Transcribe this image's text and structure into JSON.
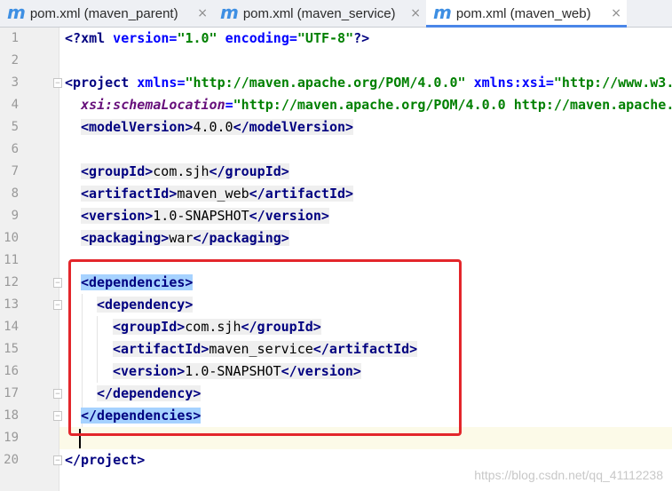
{
  "tabs": [
    {
      "icon": "m",
      "label": "pom.xml (maven_parent)",
      "close": "×",
      "active": false
    },
    {
      "icon": "m",
      "label": "pom.xml (maven_service)",
      "close": "×",
      "active": false
    },
    {
      "icon": "m",
      "label": "pom.xml (maven_web)",
      "close": "×",
      "active": true
    }
  ],
  "line_numbers": [
    "1",
    "2",
    "3",
    "4",
    "5",
    "6",
    "7",
    "8",
    "9",
    "10",
    "11",
    "12",
    "13",
    "14",
    "15",
    "16",
    "17",
    "18",
    "19",
    "20"
  ],
  "code": {
    "l1": {
      "a": "<?",
      "b": "xml",
      "c": " version",
      "d": "=",
      "e": "\"1.0\"",
      "f": " encoding",
      "g": "=",
      "h": "\"UTF-8\"",
      "i": "?>"
    },
    "l3": {
      "a": "<project",
      "b": " xmlns",
      "c": "=",
      "d": "\"http://maven.apache.org/POM/4.0.0\"",
      "e": " xmlns:xsi",
      "f": "=",
      "g": "\"http://www.w3."
    },
    "l4": {
      "a": "  ",
      "b": "xsi:schemaLocation",
      "c": "=",
      "d": "\"http://maven.apache.org/POM/4.0.0 http://maven.apache."
    },
    "l5": {
      "open": "<modelVersion>",
      "text": "4.0.0",
      "close": "</modelVersion>"
    },
    "l7": {
      "open": "<groupId>",
      "text": "com.sjh",
      "close": "</groupId>"
    },
    "l8": {
      "open": "<artifactId>",
      "text": "maven_web",
      "close": "</artifactId>"
    },
    "l9": {
      "open": "<version>",
      "text": "1.0-SNAPSHOT",
      "close": "</version>"
    },
    "l10": {
      "open": "<packaging>",
      "text": "war",
      "close": "</packaging>"
    },
    "l12": {
      "open": "<dependencies>"
    },
    "l13": {
      "open": "<dependency>"
    },
    "l14": {
      "open": "<groupId>",
      "text": "com.sjh",
      "close": "</groupId>"
    },
    "l15": {
      "open": "<artifactId>",
      "text": "maven_service",
      "close": "</artifactId>"
    },
    "l16": {
      "open": "<version>",
      "text": "1.0-SNAPSHOT",
      "close": "</version>"
    },
    "l17": {
      "close": "</dependency>"
    },
    "l18": {
      "close": "</dependencies>"
    },
    "l20": {
      "close": "</project>"
    }
  },
  "watermark": "https://blog.csdn.net/qq_41112238",
  "colors": {
    "tag": "#000080",
    "attribute": "#0000ff",
    "string": "#008000",
    "namespace_attr": "#660e7a",
    "selection": "#a6d2ff",
    "annotation_box": "#e3262b",
    "caret_line": "#fcfae8",
    "tab_icon": "#3e8fe3",
    "active_tab_underline": "#4a86e8"
  },
  "icons": {
    "tab_icon": "maven-m-icon",
    "tab_close": "close-icon",
    "fold_marker": "fold-marker-icon"
  }
}
